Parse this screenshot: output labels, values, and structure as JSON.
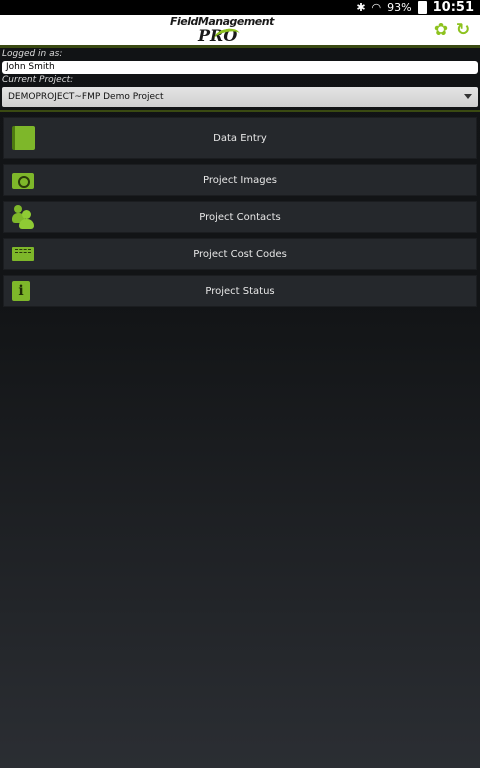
{
  "status_bar": {
    "battery": "93%",
    "time": "10:51"
  },
  "header": {
    "logo_line1": "FieldManagement",
    "logo_line2": "PRO"
  },
  "login": {
    "label": "Logged in as:",
    "value": "John Smith"
  },
  "project": {
    "label": "Current Project:",
    "value": "DEMOPROJECT~FMP Demo Project"
  },
  "menu": {
    "items": [
      {
        "label": "Data Entry",
        "icon": "notebook-icon"
      },
      {
        "label": "Project Images",
        "icon": "camera-icon"
      },
      {
        "label": "Project Contacts",
        "icon": "contacts-icon"
      },
      {
        "label": "Project Cost Codes",
        "icon": "ruler-icon"
      },
      {
        "label": "Project Status",
        "icon": "info-icon"
      }
    ]
  },
  "colors": {
    "accent": "#8dc21f",
    "background": "#121416",
    "menu_item": "#25282c"
  }
}
